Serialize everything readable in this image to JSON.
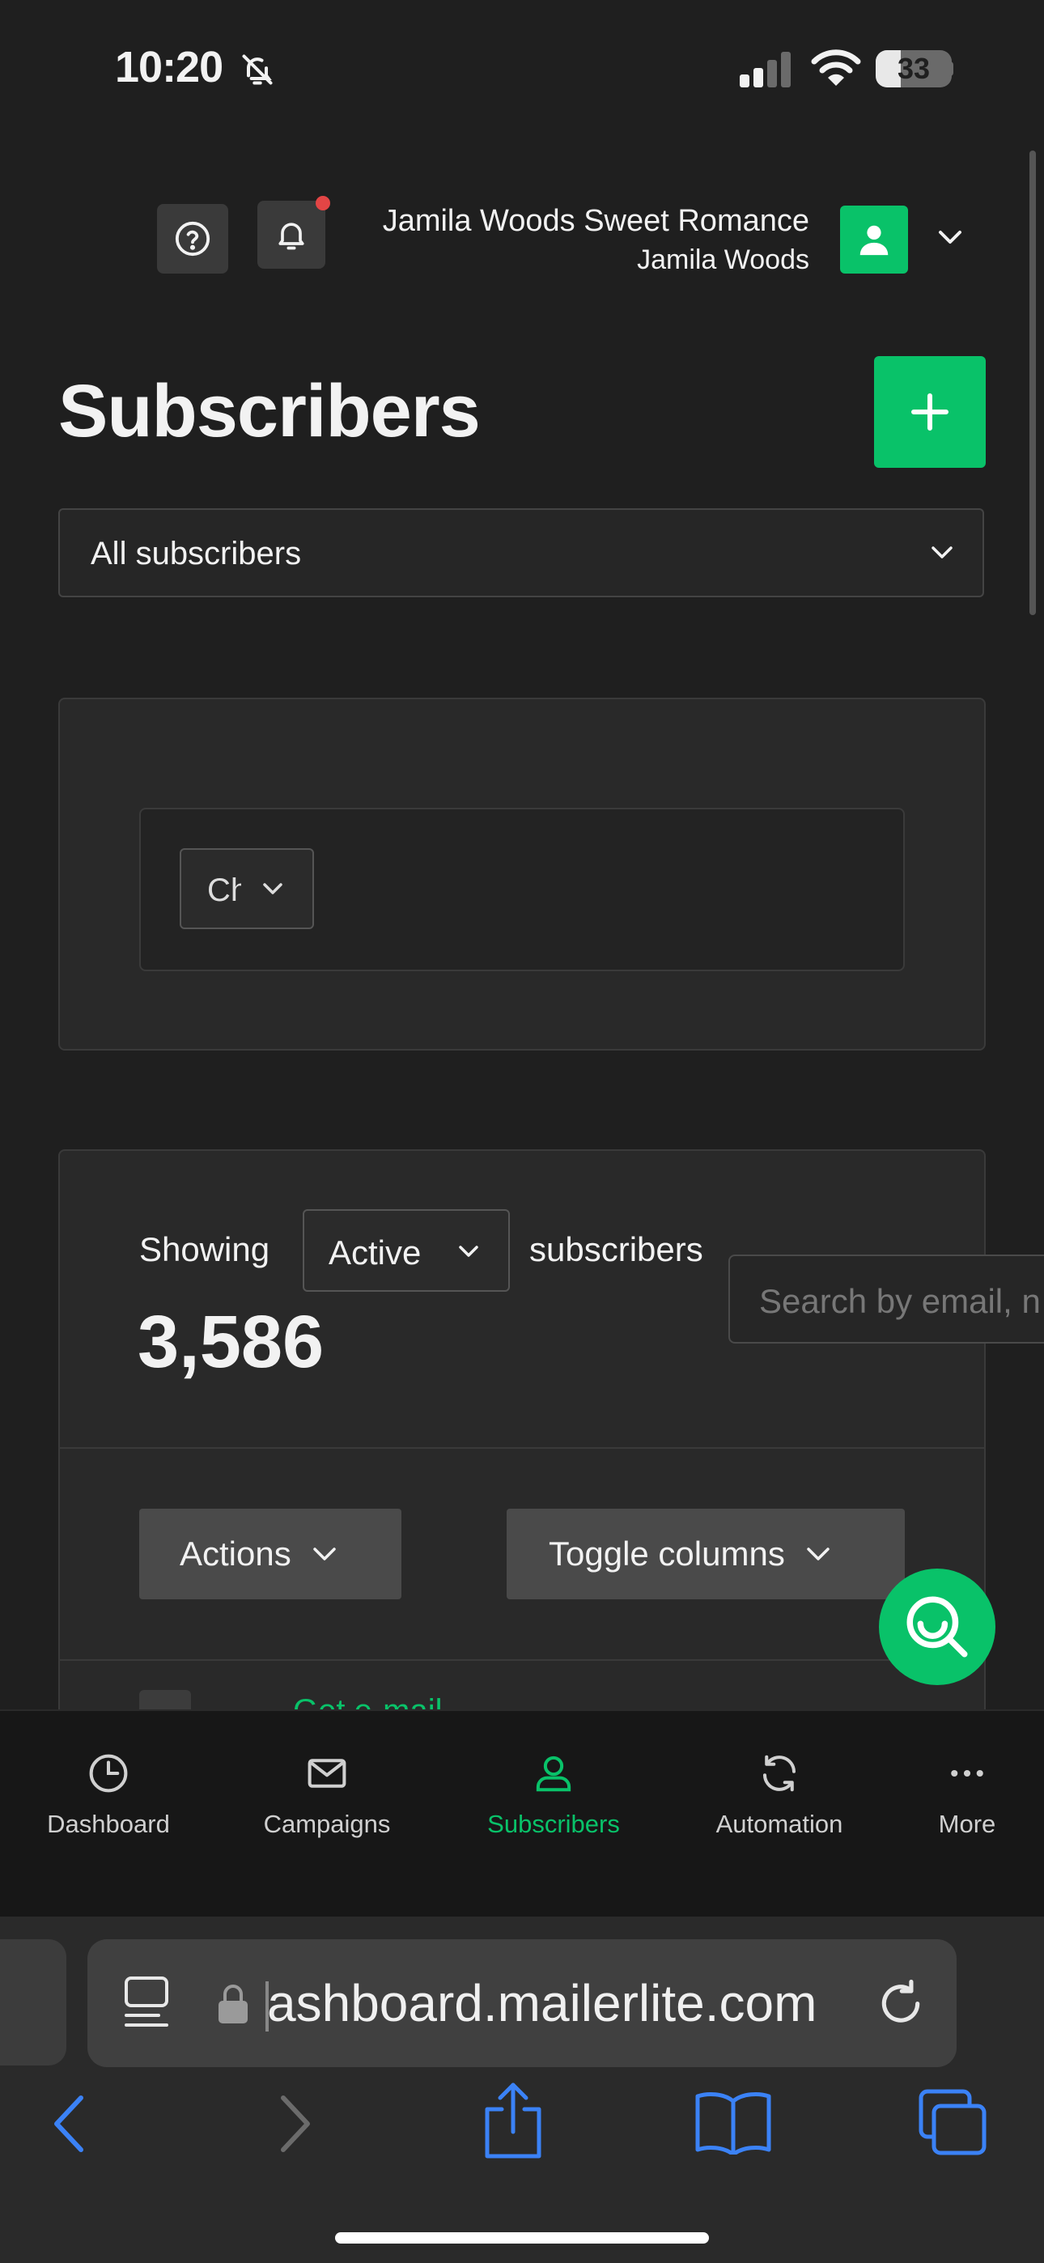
{
  "status_bar": {
    "time": "10:20",
    "battery": "33",
    "battery_level": 0.33
  },
  "header": {
    "account_name": "Jamila Woods Sweet Romance",
    "account_user": "Jamila Woods"
  },
  "page": {
    "title": "Subscribers"
  },
  "filter": {
    "selected": "All subscribers"
  },
  "chart_panel": {
    "dropdown_label": "Ch"
  },
  "list": {
    "showing_label": "Showing",
    "status_selected": "Active",
    "subscribers_label": "subscribers",
    "count": "3,586",
    "search_placeholder": "Search by email, n",
    "actions_label": "Actions",
    "toggle_columns_label": "Toggle columns",
    "first_row_email": "Get e-mail"
  },
  "bottom_nav": [
    {
      "label": "Dashboard",
      "icon": "pie-chart-icon"
    },
    {
      "label": "Campaigns",
      "icon": "mail-icon"
    },
    {
      "label": "Subscribers",
      "icon": "user-icon",
      "active": true
    },
    {
      "label": "Automation",
      "icon": "refresh-icon"
    },
    {
      "label": "More",
      "icon": "more-icon"
    }
  ],
  "browser": {
    "url": "ashboard.mailerlite.com"
  },
  "colors": {
    "accent": "#09c269",
    "background": "#1f1f1f",
    "notification": "#e34545"
  }
}
